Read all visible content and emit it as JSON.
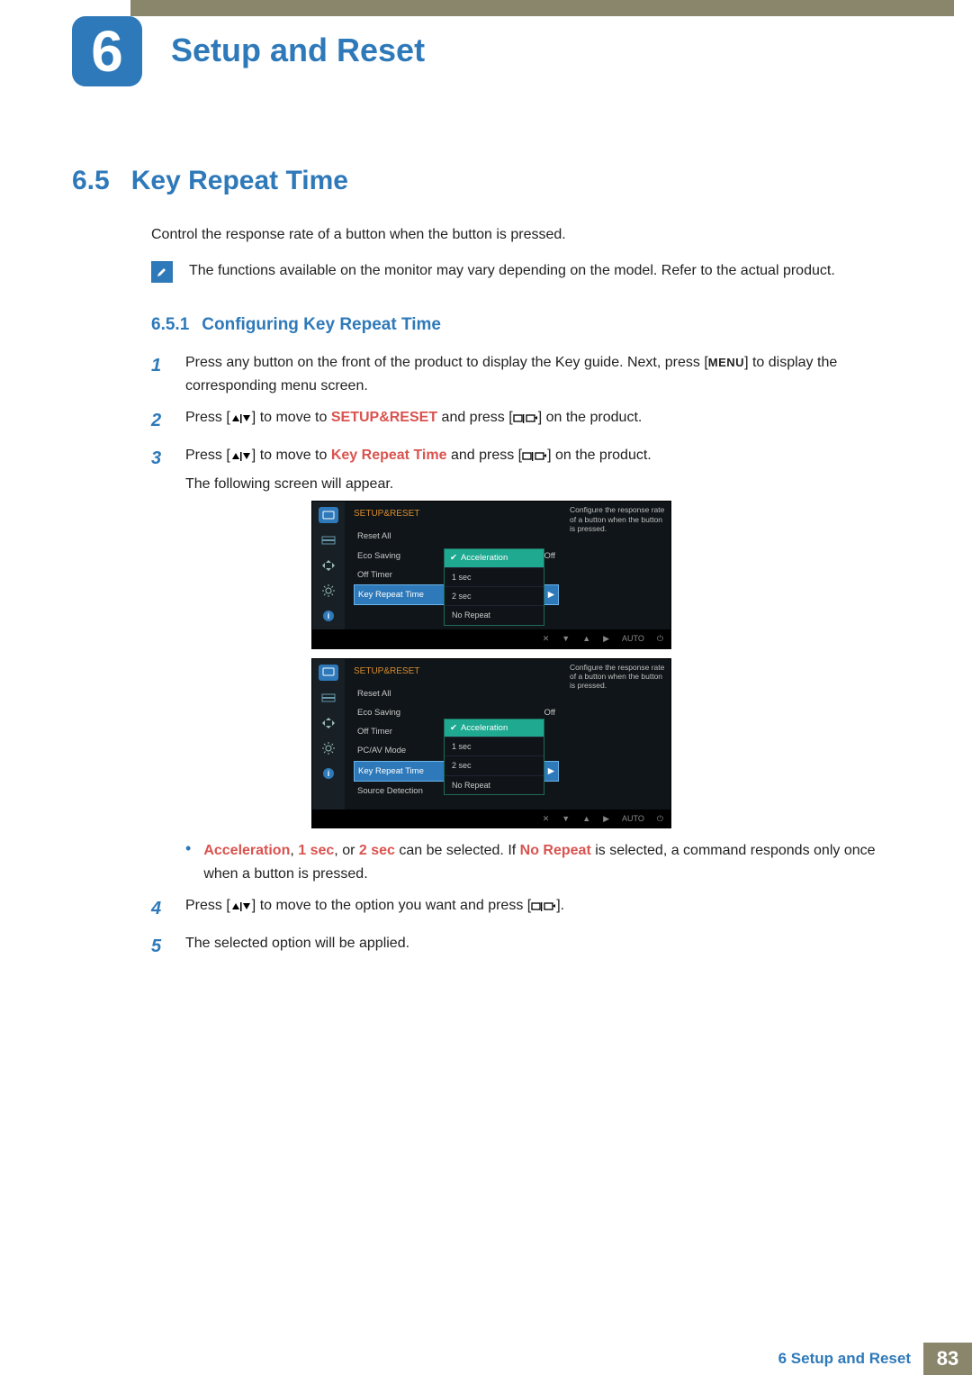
{
  "chapter": {
    "number": "6",
    "title": "Setup and Reset"
  },
  "section": {
    "number": "6.5",
    "title": "Key Repeat Time"
  },
  "intro": "Control the response rate of a button when the button is pressed.",
  "note": "The functions available on the monitor may vary depending on the model. Refer to the actual product.",
  "subsection": {
    "number": "6.5.1",
    "title": "Configuring Key Repeat Time"
  },
  "steps": {
    "s1a": "Press any button on the front of the product to display the Key guide. Next, press [",
    "s1b": "] to display the corresponding menu screen.",
    "menu_label": "MENU",
    "s2a": "Press [",
    "s2b": "] to move to ",
    "s2c": " and press [",
    "s2d": "] on the product.",
    "setup_reset": "SETUP&RESET",
    "s3a": "Press [",
    "s3b": "] to move to ",
    "s3c": " and press [",
    "s3d": "] on the product.",
    "key_repeat": "Key Repeat Time",
    "s3_tail": "The following screen will appear.",
    "bullet_pre": "",
    "acc": "Acceleration",
    "comma": ", ",
    "one": "1 sec",
    "or": ", or ",
    "two": "2 sec",
    "can": " can be selected. If ",
    "nr": "No Repeat",
    "bullet_tail": " is selected, a command responds only once when a button is pressed.",
    "s4a": "Press [",
    "s4b": "] to move to the option you want and press [",
    "s4c": "].",
    "s5": "The selected option will be applied.",
    "nums": {
      "n1": "1",
      "n2": "2",
      "n3": "3",
      "n4": "4",
      "n5": "5"
    }
  },
  "osd": {
    "title": "SETUP&RESET",
    "desc": "Configure the response rate of a button when the button is pressed.",
    "eco_off": "Off",
    "items1": [
      "Reset All",
      "Eco Saving",
      "Off Timer",
      "Key Repeat Time"
    ],
    "items2": [
      "Reset All",
      "Eco Saving",
      "Off Timer",
      "PC/AV Mode",
      "Key Repeat Time",
      "Source Detection"
    ],
    "popup_head": "Acceleration",
    "popup": [
      "1 sec",
      "2 sec",
      "No Repeat"
    ],
    "bottom_auto": "AUTO"
  },
  "footer": {
    "label": "6 Setup and Reset",
    "page": "83"
  }
}
